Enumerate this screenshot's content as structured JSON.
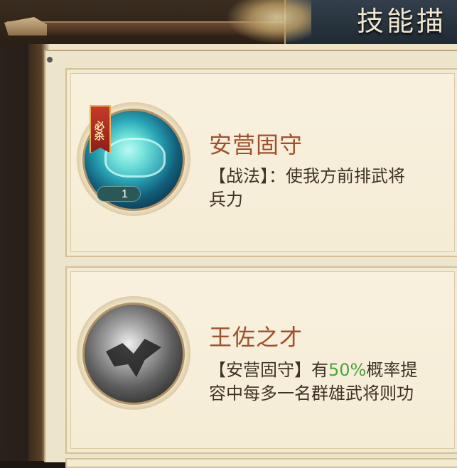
{
  "header": {
    "title": "技能描"
  },
  "skills": [
    {
      "name": "安营固守",
      "tag": "必杀",
      "level": "1",
      "desc_line1": "【战法】：使我方前排武将",
      "desc_line2": "兵力",
      "icon": "ghost-orb-icon",
      "icon_color": "#2aa6b6"
    },
    {
      "name": "王佐之才",
      "desc_prefix": "【安营固守】有",
      "desc_highlight": "50%",
      "desc_suffix": "概率提",
      "desc_line2": "容中每多一名群雄武将则功",
      "icon": "black-crow-icon",
      "highlight_color": "#4da53a"
    }
  ]
}
